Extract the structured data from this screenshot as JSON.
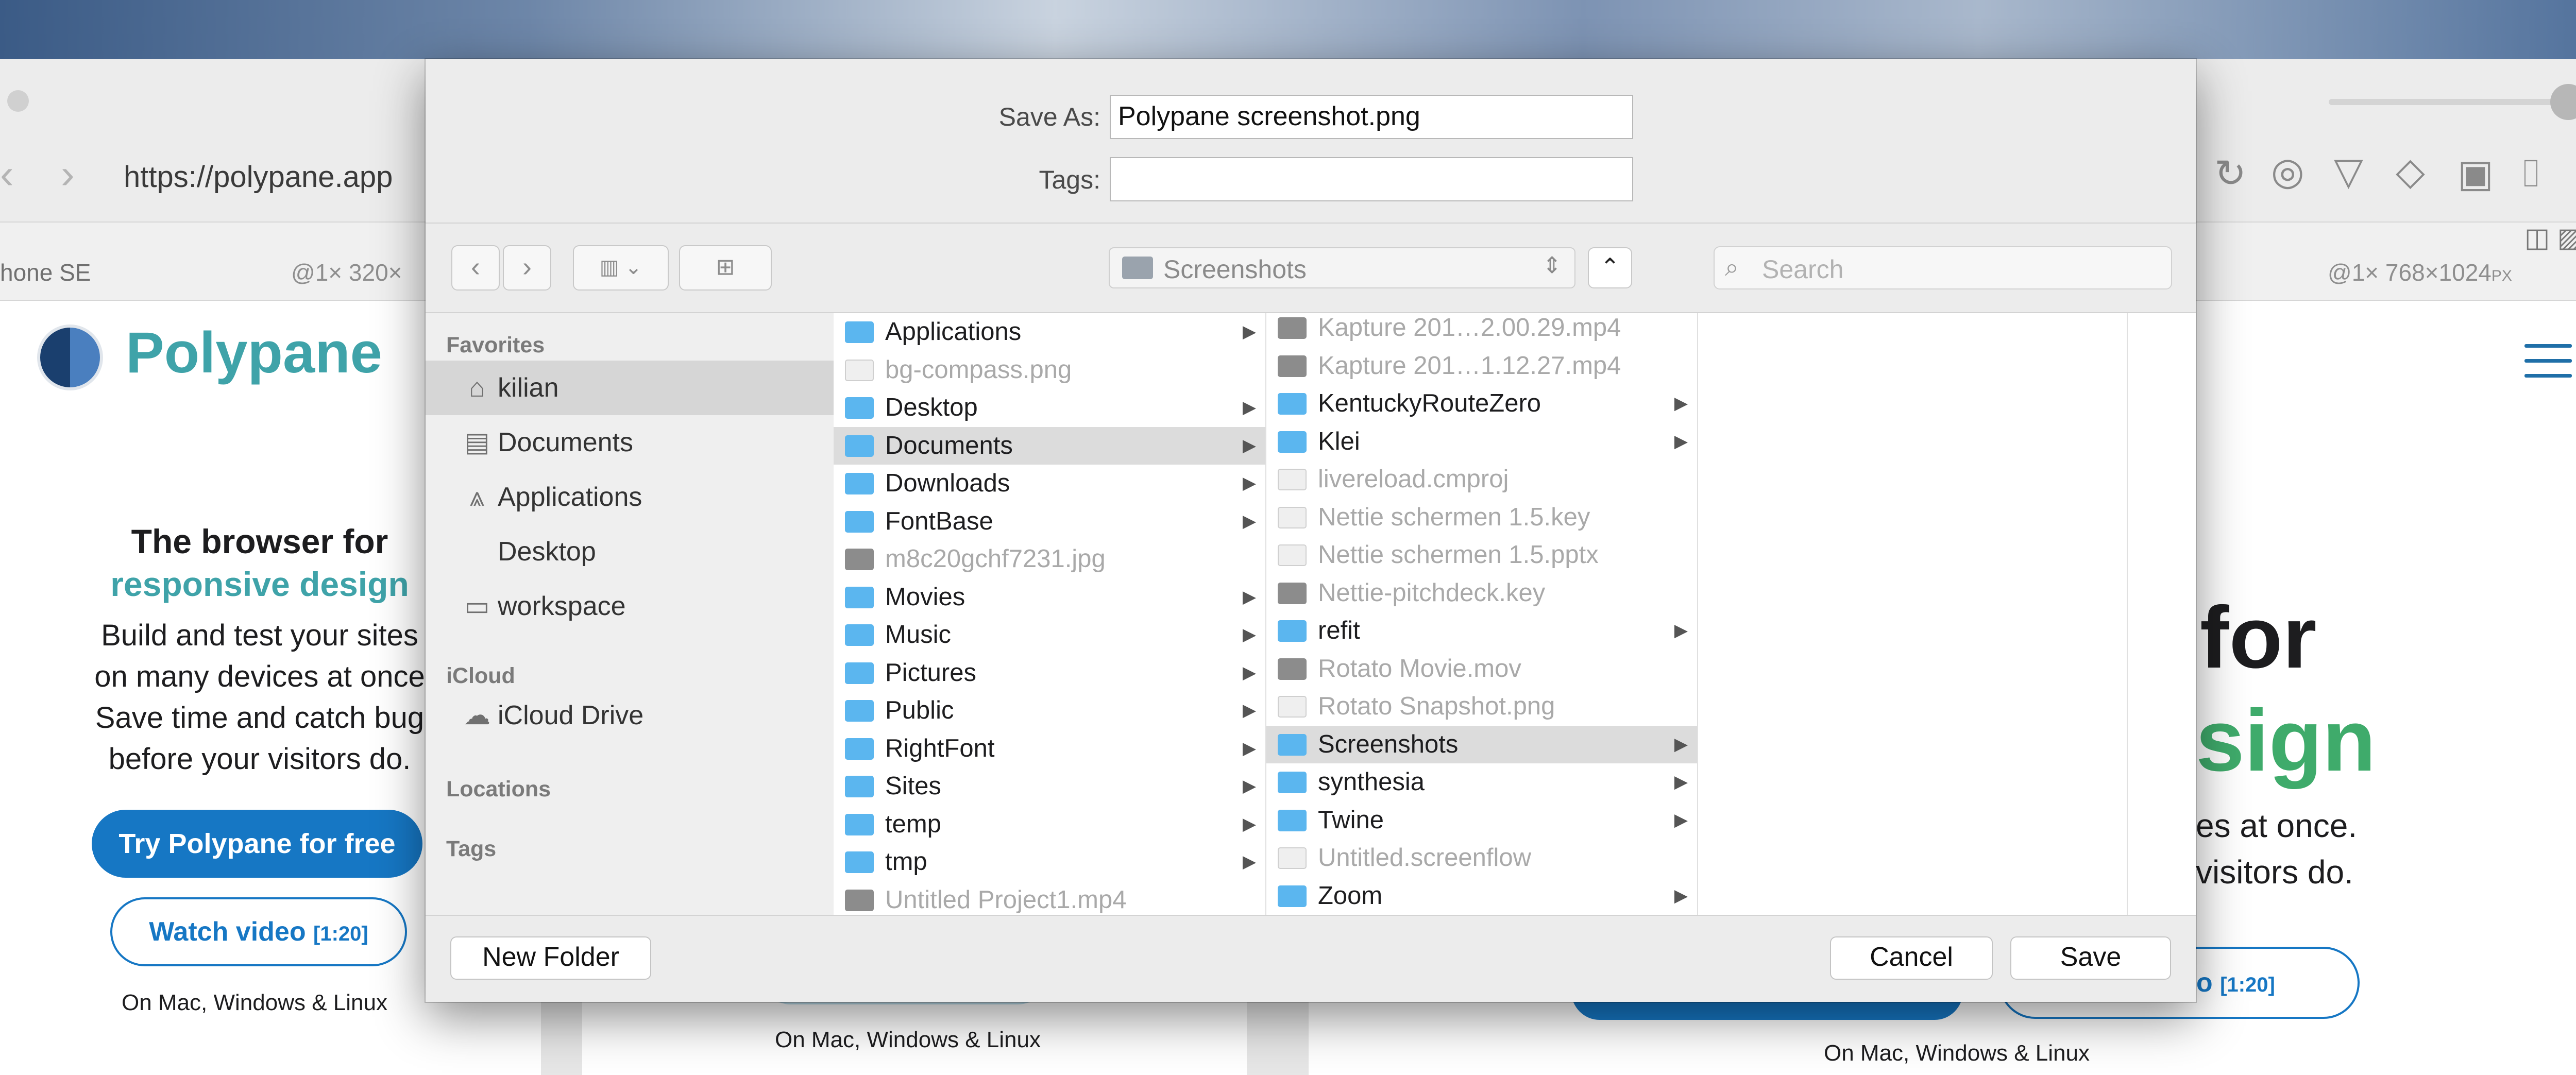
{
  "browser": {
    "url": "https://polypane.app",
    "left_device": "hone SE",
    "left_dims": "@1× 320×",
    "right_dims": "@1× 768×1024",
    "right_dims_unit": "PX"
  },
  "site": {
    "logo_text": "Polypane",
    "hero_line1": "The browser for",
    "hero_line2": "responsive design",
    "hero_p1": "Build and test your sites",
    "hero_p2": "on many devices at once",
    "hero_p3": "Save time and catch bug",
    "hero_p4": "before your visitors do.",
    "try_label": "Try Polypane for free",
    "watch_label": "Watch video",
    "watch_time": "[1:20]",
    "platforms_left": "On Mac, Windows & Linux",
    "platforms_mid": "On Mac, Windows & Linux",
    "platforms_right": "On Mac, Windows & Linux",
    "right_for": "for",
    "right_sign": "sign",
    "right_p1": "es at once.",
    "right_p2": "visitors do.",
    "right_watch": "eo",
    "right_watch_time": "[1:20]"
  },
  "dialog": {
    "save_as_label": "Save As:",
    "save_as_value": "Polypane screenshot.png",
    "tags_label": "Tags:",
    "tags_value": "",
    "location": "Screenshots",
    "search_placeholder": "Search",
    "new_folder": "New Folder",
    "cancel": "Cancel",
    "save": "Save"
  },
  "sidebar": {
    "favorites_header": "Favorites",
    "favorites": [
      {
        "label": "kilian",
        "icon": "home-icon",
        "selected": true
      },
      {
        "label": "Documents",
        "icon": "documents-icon"
      },
      {
        "label": "Applications",
        "icon": "applications-icon"
      },
      {
        "label": "Desktop",
        "icon": ""
      },
      {
        "label": "workspace",
        "icon": "folder-icon"
      }
    ],
    "icloud_header": "iCloud",
    "icloud_drive": "iCloud Drive",
    "locations_header": "Locations",
    "tags_header": "Tags"
  },
  "columns": {
    "col1": [
      {
        "name": "Applications",
        "kind": "folder",
        "arrow": true
      },
      {
        "name": "bg-compass.png",
        "kind": "file",
        "dim": true
      },
      {
        "name": "Desktop",
        "kind": "folder",
        "arrow": true
      },
      {
        "name": "Documents",
        "kind": "folder",
        "arrow": true,
        "selected": true
      },
      {
        "name": "Downloads",
        "kind": "folder",
        "arrow": true
      },
      {
        "name": "FontBase",
        "kind": "folder",
        "arrow": true
      },
      {
        "name": "m8c20gchf7231.jpg",
        "kind": "img",
        "dim": true
      },
      {
        "name": "Movies",
        "kind": "folder",
        "arrow": true
      },
      {
        "name": "Music",
        "kind": "folder",
        "arrow": true
      },
      {
        "name": "Pictures",
        "kind": "folder",
        "arrow": true
      },
      {
        "name": "Public",
        "kind": "folder",
        "arrow": true
      },
      {
        "name": "RightFont",
        "kind": "folder",
        "arrow": true
      },
      {
        "name": "Sites",
        "kind": "folder",
        "arrow": true
      },
      {
        "name": "temp",
        "kind": "folder",
        "arrow": true
      },
      {
        "name": "tmp",
        "kind": "folder",
        "arrow": true
      },
      {
        "name": "Untitled Project1.mp4",
        "kind": "img",
        "dim": true
      }
    ],
    "col2": [
      {
        "name": "Kapture 201…2.00.29.mp4",
        "kind": "img",
        "dim": true
      },
      {
        "name": "Kapture 201…1.12.27.mp4",
        "kind": "img",
        "dim": true
      },
      {
        "name": "KentuckyRouteZero",
        "kind": "folder",
        "arrow": true
      },
      {
        "name": "Klei",
        "kind": "folder",
        "arrow": true
      },
      {
        "name": "livereload.cmproj",
        "kind": "file",
        "dim": true
      },
      {
        "name": "Nettie schermen 1.5.key",
        "kind": "file",
        "dim": true
      },
      {
        "name": "Nettie schermen 1.5.pptx",
        "kind": "file",
        "dim": true
      },
      {
        "name": "Nettie-pitchdeck.key",
        "kind": "img",
        "dim": true
      },
      {
        "name": "refit",
        "kind": "folder",
        "arrow": true
      },
      {
        "name": "Rotato Movie.mov",
        "kind": "img",
        "dim": true
      },
      {
        "name": "Rotato Snapshot.png",
        "kind": "file",
        "dim": true
      },
      {
        "name": "Screenshots",
        "kind": "folder",
        "arrow": true,
        "selected": true
      },
      {
        "name": "synthesia",
        "kind": "folder",
        "arrow": true
      },
      {
        "name": "Twine",
        "kind": "folder",
        "arrow": true
      },
      {
        "name": "Untitled.screenflow",
        "kind": "file",
        "dim": true
      },
      {
        "name": "Zoom",
        "kind": "folder",
        "arrow": true
      }
    ]
  },
  "colors": {
    "accent_blue": "#1677c4",
    "brand_teal": "#3fa3a9",
    "brand_green": "#3fab6b",
    "folder_blue": "#5bb6ef"
  }
}
